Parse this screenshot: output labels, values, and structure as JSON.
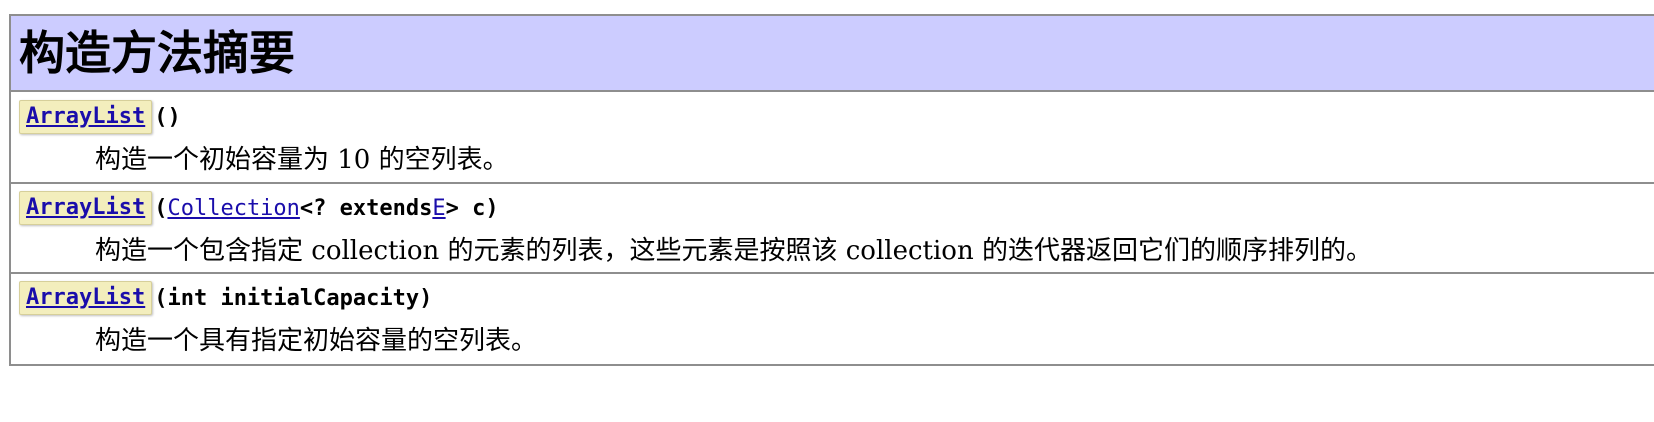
{
  "section": {
    "title": "构造方法摘要"
  },
  "constructors": [
    {
      "name": "ArrayList",
      "params_text": "()",
      "description": "构造一个初始容量为 10 的空列表。"
    },
    {
      "name": "ArrayList",
      "open_paren": "(",
      "param_type_link": "Collection",
      "param_middle": "<? extends ",
      "param_generic_link": "E",
      "param_end": "> c)",
      "description": "构造一个包含指定 collection 的元素的列表，这些元素是按照该 collection 的迭代器返回它们的顺序排列的。"
    },
    {
      "name": "ArrayList",
      "params_text": "(int initialCapacity)",
      "description": "构造一个具有指定初始容量的空列表。"
    }
  ],
  "colors": {
    "header_bg": "#ccccff",
    "link": "#1a0dab",
    "link_highlight": "#f3eebd",
    "border": "#8e8e8e"
  }
}
